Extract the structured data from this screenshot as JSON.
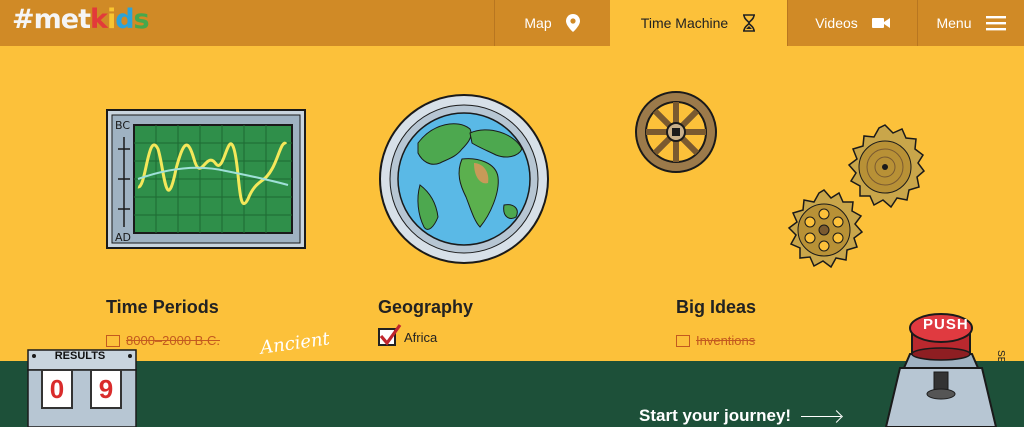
{
  "header": {
    "logo": {
      "hash": "#",
      "met": "met",
      "k": "k",
      "i": "i",
      "d": "d",
      "s": "s"
    },
    "nav": [
      {
        "label": "Map",
        "icon": "map-pin-icon"
      },
      {
        "label": "Time Machine",
        "icon": "hourglass-icon"
      },
      {
        "label": "Videos",
        "icon": "video-camera-icon"
      },
      {
        "label": "Menu",
        "icon": "hamburger-menu-icon"
      }
    ]
  },
  "monitor": {
    "top_label": "BC",
    "bottom_label": "AD"
  },
  "sections": {
    "time_periods": {
      "title": "Time Periods",
      "first_item": "8000–2000 B.C.",
      "handwritten_label": "Ancient"
    },
    "geography": {
      "title": "Geography",
      "first_item": "Africa",
      "first_checked": true
    },
    "big_ideas": {
      "title": "Big Ideas",
      "first_item": "Inventions"
    }
  },
  "side_text": "SE !!)",
  "results": {
    "label": "RESULTS",
    "digits": [
      "0",
      "9"
    ]
  },
  "push_button": {
    "label": "PUSH"
  },
  "cta": {
    "label": "Start your journey!"
  },
  "colors": {
    "header_bg": "#D08A26",
    "page_bg": "#FCC13A",
    "footer_bg": "#1D5039",
    "strike_text": "#C35A1F",
    "digit_red": "#D92C2C"
  }
}
